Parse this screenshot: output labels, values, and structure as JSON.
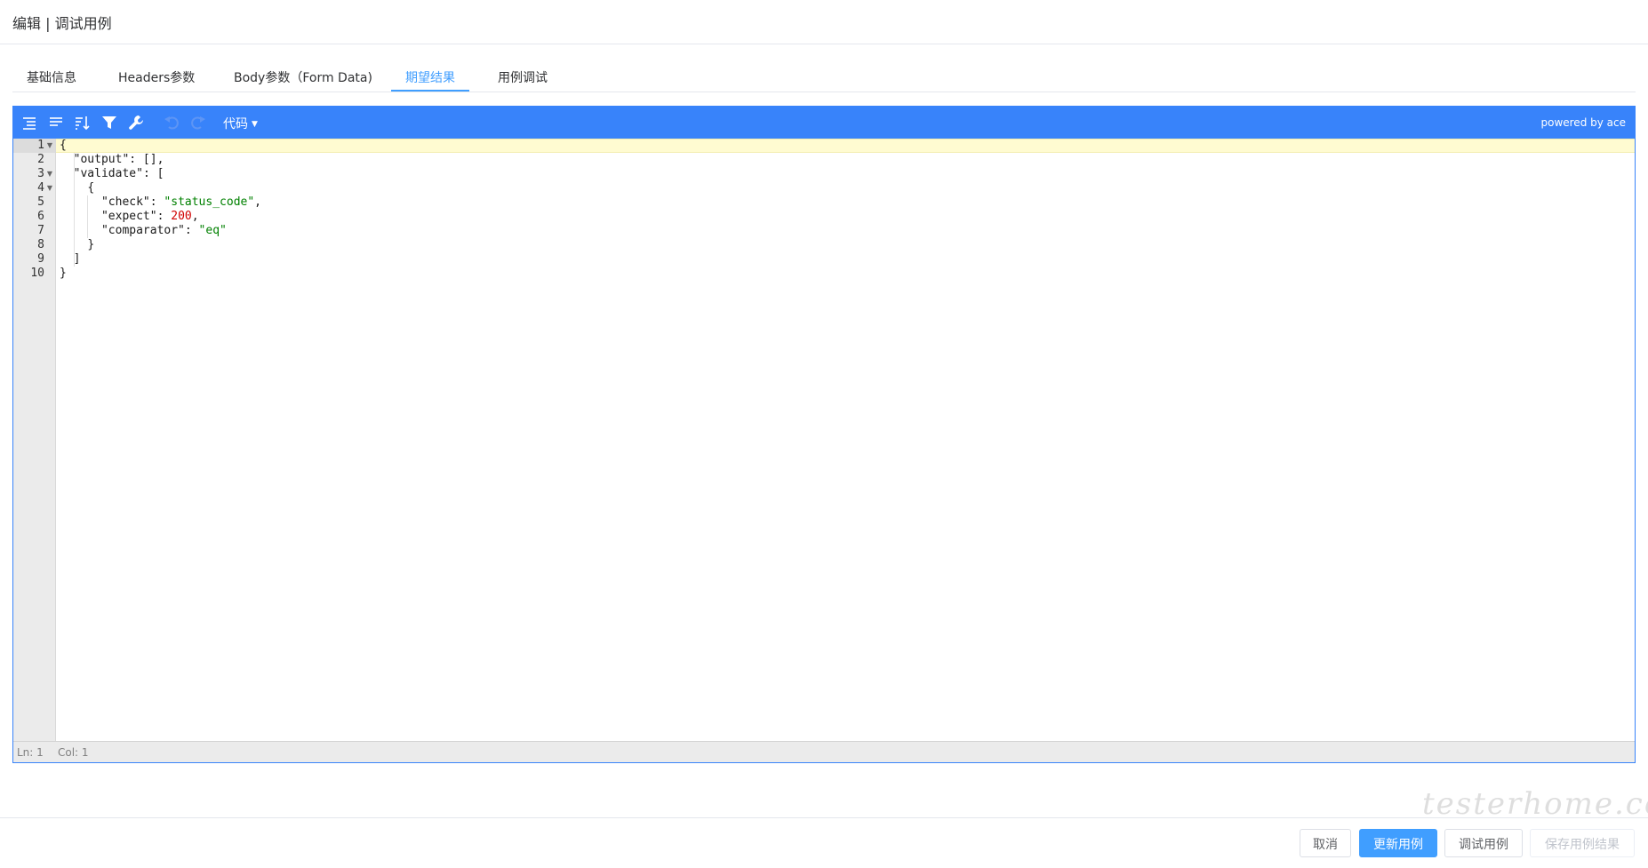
{
  "header": {
    "title": "编辑 | 调试用例"
  },
  "tabs": [
    {
      "label": "基础信息"
    },
    {
      "label": "Headers参数"
    },
    {
      "label": "Body参数（Form Data)"
    },
    {
      "label": "期望结果"
    },
    {
      "label": "用例调试"
    }
  ],
  "active_tab": "期望结果",
  "editor": {
    "toolbar": {
      "icons": [
        "format-icon",
        "compact-icon",
        "sort-icon",
        "filter-icon",
        "repair-icon",
        "undo-icon",
        "redo-icon"
      ],
      "mode_label": "代码",
      "powered_by": "powered by ace"
    },
    "line_numbers": [
      "1",
      "2",
      "3",
      "4",
      "5",
      "6",
      "7",
      "8",
      "9",
      "10"
    ],
    "colors": {
      "accent": "#3883fa",
      "string": "#008000",
      "number": "#d00000"
    },
    "code": {
      "l1": "{",
      "l2_key": "\"output\"",
      "l2_rest": ": [],",
      "l3_key": "\"validate\"",
      "l3_rest": ": [",
      "l4": "{",
      "l5_key": "\"check\"",
      "l5_sep": ": ",
      "l5_val": "\"status_code\"",
      "l5_end": ",",
      "l6_key": "\"expect\"",
      "l6_sep": ": ",
      "l6_val": "200",
      "l6_end": ",",
      "l7_key": "\"comparator\"",
      "l7_sep": ": ",
      "l7_val": "\"eq\"",
      "l8": "}",
      "l9": "]",
      "l10": "}"
    },
    "status": {
      "ln": "Ln: 1",
      "col": "Col: 1"
    }
  },
  "footer": {
    "cancel": "取消",
    "update": "更新用例",
    "debug": "调试用例",
    "save_result": "保存用例结果"
  },
  "watermark": "testerhome.com"
}
